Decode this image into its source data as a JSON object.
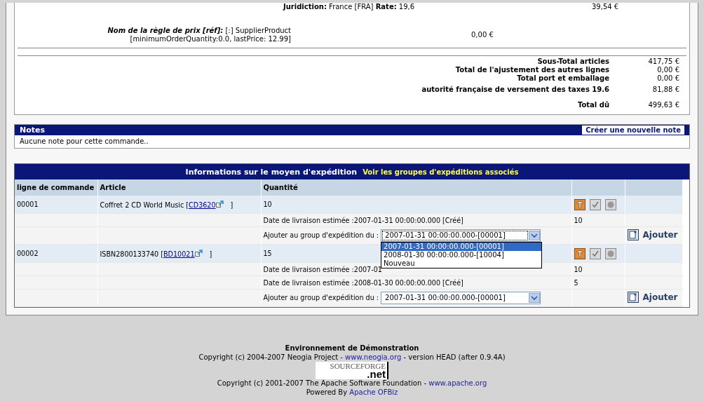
{
  "adjustment": {
    "text": "**Juridiction:** France [FRA] **Rate:** 19,6",
    "amount": "39,54 €"
  },
  "price_rule": {
    "label": "Nom de la règle de prix [réf]:",
    "line_1": "[:] SupplierProduct",
    "line_2": "[minimumOrderQuantity:0.0, lastPrice: 12.99]",
    "amount": "0,00 €"
  },
  "totals": [
    {
      "label": "Sous-Total articles",
      "value": "417,75 €"
    },
    {
      "label": "Total de l'ajustement des autres lignes",
      "value": "0,00 €"
    },
    {
      "label": "Total port et emballage",
      "value": "0,00 €"
    },
    {
      "label": "autorité française de versement des taxes 19.6",
      "value": "81,88 €"
    },
    {
      "label": "Total dû",
      "value": "499,63 €"
    }
  ],
  "notes": {
    "title": "Notes",
    "create_button": "Créer une nouvelle note",
    "empty_text": "Aucune note pour cette commande.."
  },
  "shipping": {
    "title": "Informations sur le moyen d'expédition",
    "groups_link": "Voir les groupes d'expéditions associés",
    "columns": [
      "ligne de commande",
      "Article",
      "Quantité"
    ],
    "items": [
      {
        "line": "00001",
        "article": "Coffret 2 CD World Music [",
        "product_id": "CD3620",
        "article_end": "]",
        "quantity": "10",
        "deliveries": [
          {
            "text": "Date de livraison estimée :2007-01-31 00:00:00.000 [Créé]",
            "quantity": "10"
          }
        ],
        "add_label": "Ajouter au group d'expédition du :",
        "select_value": "2007-01-31 00:00:00.000-[00001]",
        "expanded": true,
        "options": [
          {
            "label": "2007-01-31 00:00:00.000-[00001]",
            "selected": true
          },
          {
            "label": "2008-01-30 00:00:00.000-[10004]",
            "selected": false
          },
          {
            "label": "Nouveau",
            "selected": false
          }
        ],
        "add_button": "Ajouter"
      },
      {
        "line": "00002",
        "article": "ISBN2800133740 [",
        "product_id": "BD10021",
        "article_end": "]",
        "quantity": "15",
        "deliveries": [
          {
            "text": "Date de livraison estimée :2007-01",
            "quantity": "10"
          },
          {
            "text": "Date de livraison estimée :2008-01-30 00:00:00.000 [Créé]",
            "quantity": "5"
          }
        ],
        "add_label": "Ajouter au group d'expédition du :",
        "select_value": "2007-01-31 00:00:00.000-[00001]",
        "expanded": false,
        "add_button": "Ajouter"
      }
    ]
  },
  "footer": {
    "title": "Environnement de Démonstration",
    "line_1": {
      "before": "Copyright (c) 2004-2007 Neogia Project - ",
      "link": "www.neogia.org",
      "after": " - version HEAD (after 0.9.4A)"
    },
    "logo": {
      "word": "SOURCEFORGE",
      "suffix": ".net"
    },
    "line_2": {
      "before": "Copyright (c) 2001-2007 The Apache Software Foundation - ",
      "link": "www.apache.org"
    },
    "line_3": {
      "before": "Powered By ",
      "link": "Apache OFBiz"
    }
  }
}
